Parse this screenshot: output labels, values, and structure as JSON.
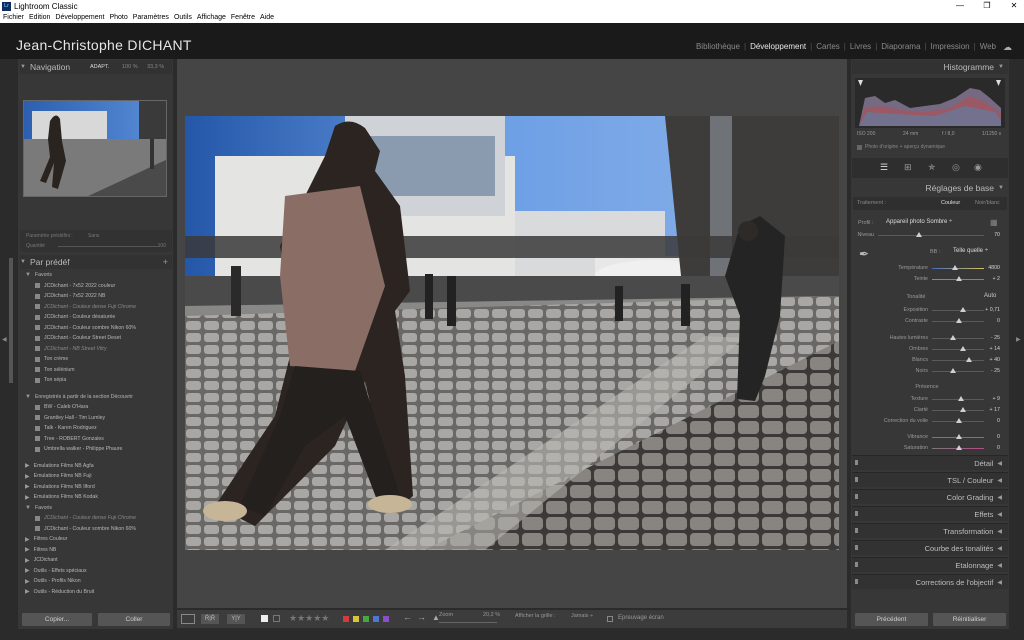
{
  "window": {
    "title": "Lightroom Classic",
    "app_icon_text": "Lr"
  },
  "menu": [
    "Fichier",
    "Edition",
    "Développement",
    "Photo",
    "Paramètres",
    "Outils",
    "Affichage",
    "Fenêtre",
    "Aide"
  ],
  "identity": {
    "name": "Jean-Christophe DICHANT"
  },
  "modules": [
    "Bibliothèque",
    "Développement",
    "Cartes",
    "Livres",
    "Diaporama",
    "Impression",
    "Web"
  ],
  "active_module": "Développement",
  "left": {
    "navigator": {
      "title": "Navigation",
      "zoom_opts": [
        "ADAPT.",
        "100 %",
        "33,3 %"
      ]
    },
    "preset_amount": {
      "label": "Paramètre prédéfini :",
      "value": "Sans",
      "qty_label": "Quantité",
      "qty_value": "100"
    },
    "presets_title": "Par prédéf",
    "presets": [
      {
        "t": "Favoris",
        "kind": "group"
      },
      {
        "t": "JCDichant - 7x52 2022 couleur",
        "kind": "item"
      },
      {
        "t": "JCDichant - 7x52 2022 NB",
        "kind": "item"
      },
      {
        "t": "JCDichant - Couleur dense Fuji Chrome",
        "kind": "dim"
      },
      {
        "t": "JCDichant - Couleur désaturée",
        "kind": "item"
      },
      {
        "t": "JCDichant - Couleur sombre Nikon 60%",
        "kind": "item"
      },
      {
        "t": "JCDichant - Couleur Street Deset",
        "kind": "item"
      },
      {
        "t": "JCDichant - NB Street Vitry",
        "kind": "dim"
      },
      {
        "t": "Ton crème",
        "kind": "item"
      },
      {
        "t": "Ton sélénium",
        "kind": "item"
      },
      {
        "t": "Ton sépia",
        "kind": "item"
      },
      {
        "t": "",
        "kind": "gap"
      },
      {
        "t": "Enregistrés à partir de la section Découvrir",
        "kind": "group"
      },
      {
        "t": "BW - Caleb O'Hara",
        "kind": "item"
      },
      {
        "t": "Grantley Hall - Tim Lumley",
        "kind": "item"
      },
      {
        "t": "Talk - Karen Rodriguez",
        "kind": "item"
      },
      {
        "t": "Tree - ROBERT Gonzales",
        "kind": "item"
      },
      {
        "t": "Umbrella walker - Philippe Phaure",
        "kind": "item"
      },
      {
        "t": "",
        "kind": "gap"
      },
      {
        "t": "Emulations Films NB Agfa",
        "kind": "collapsed"
      },
      {
        "t": "Emulations Films NB Fuji",
        "kind": "collapsed"
      },
      {
        "t": "Emulations Films NB Ilford",
        "kind": "collapsed"
      },
      {
        "t": "Emulations Films NB Kodak",
        "kind": "collapsed"
      },
      {
        "t": "Favoris",
        "kind": "group"
      },
      {
        "t": "JCDichant - Couleur dense Fuji Chrome",
        "kind": "dim"
      },
      {
        "t": "JCDichant - Couleur sombre Nikon 60%",
        "kind": "item"
      },
      {
        "t": "Filtres Couleur",
        "kind": "collapsed"
      },
      {
        "t": "Filtres NB",
        "kind": "collapsed"
      },
      {
        "t": "JCDichant",
        "kind": "collapsed"
      },
      {
        "t": "Outils - Effets spéciaux",
        "kind": "collapsed"
      },
      {
        "t": "Outils - Profils Nikon",
        "kind": "collapsed"
      },
      {
        "t": "Outils - Réduction du Bruit",
        "kind": "collapsed"
      }
    ],
    "copy_btn": "Copier...",
    "paste_btn": "Coller"
  },
  "toolbar": {
    "stars": "★★★★★",
    "color_labels": [
      "#d23b3b",
      "#d6c43a",
      "#45a845",
      "#4a79d0",
      "#8a4ec6"
    ],
    "zoom_label": "Zoom",
    "zoom_value": "20,2 %",
    "grid_label": "Afficher la grille :",
    "grid_value": "Jamais ÷",
    "softproof_label": "Epreuvage écran"
  },
  "right": {
    "histogram": {
      "title": "Histogramme",
      "iso": "ISO 200",
      "focal": "24 mm",
      "aperture": "f / 8,0",
      "shutter": "1/1250 s",
      "note": "Photo d'origine + aperçu dynamique"
    },
    "basic": {
      "title": "Réglages de base",
      "treatment_label": "Traitement :",
      "treatment_color": "Couleur",
      "treatment_bw": "Noir/blanc",
      "profile_label": "Profil :",
      "profile_value": "Appareil photo Sombre ÷",
      "level_label": "Niveau",
      "level_value": "70",
      "wb_label": "BB :",
      "wb_value": "Telle quelle ÷",
      "temp_label": "Température",
      "temp_value": "4800",
      "tint_label": "Teinte",
      "tint_value": "+ 2",
      "tone_label": "Tonalité",
      "auto_label": "Auto",
      "exposure_label": "Exposition",
      "exposure_value": "+ 0,71",
      "contrast_label": "Contraste",
      "contrast_value": "0",
      "highlights_label": "Hautes lumières",
      "highlights_value": "- 25",
      "shadows_label": "Ombres",
      "shadows_value": "+ 14",
      "whites_label": "Blancs",
      "whites_value": "+ 40",
      "blacks_label": "Noirs",
      "blacks_value": "- 25",
      "presence_label": "Présence",
      "texture_label": "Texture",
      "texture_value": "+ 9",
      "clarity_label": "Clarté",
      "clarity_value": "+ 17",
      "dehaze_label": "Correction du voile",
      "dehaze_value": "0",
      "vibrance_label": "Vibrance",
      "vibrance_value": "0",
      "saturation_label": "Saturation",
      "saturation_value": "0"
    },
    "sections": [
      "Détail",
      "TSL / Couleur",
      "Color Grading",
      "Effets",
      "Transformation",
      "Courbe des tonalités",
      "Etalonnage",
      "Corrections de l'objectif"
    ],
    "prev_btn": "Précédent",
    "reset_btn": "Réinitialiser"
  }
}
